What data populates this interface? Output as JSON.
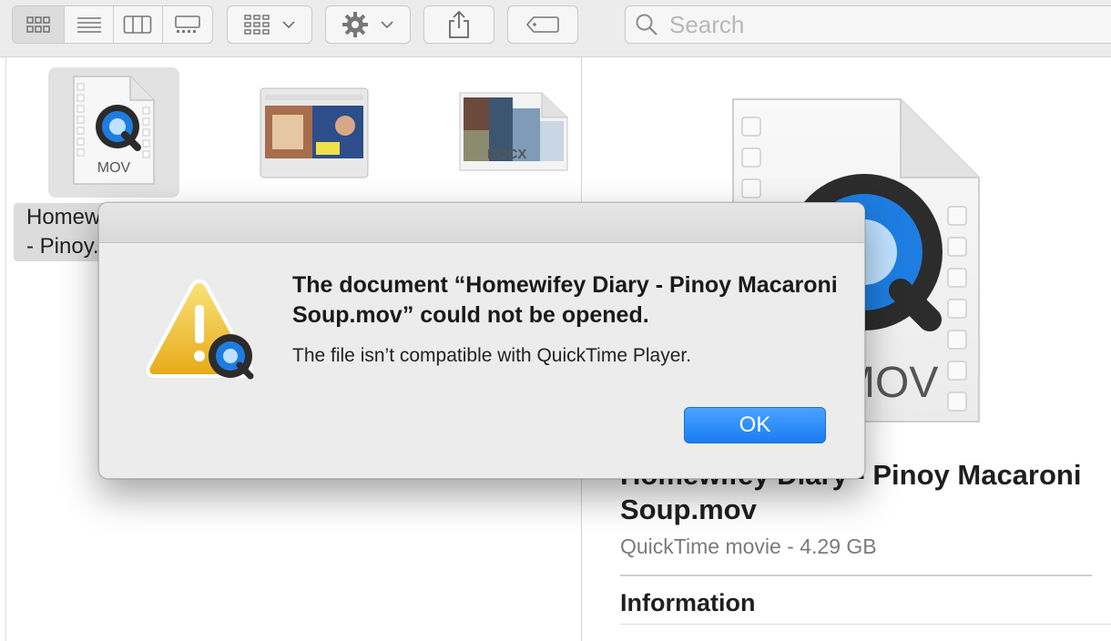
{
  "toolbar": {
    "view_modes": [
      {
        "name": "icon-view-icon",
        "active": true
      },
      {
        "name": "list-view-icon",
        "active": false
      },
      {
        "name": "column-view-icon",
        "active": false
      },
      {
        "name": "gallery-view-icon",
        "active": false
      }
    ],
    "group_icon": "group-by-icon",
    "action_icon": "gear-icon",
    "share_icon": "share-icon",
    "tag_icon": "tag-icon",
    "search_placeholder": "Search"
  },
  "files": [
    {
      "name": "Homewifey Diary - Pinoy Macaroni Soup.mov",
      "label_line1": "Homew",
      "label_line2": "- Pinoy.",
      "badge": "MOV",
      "selected": true
    },
    {
      "name": "slide-image",
      "badge": "",
      "selected": false
    },
    {
      "name": "docx-document",
      "badge": "DOCX",
      "selected": false
    }
  ],
  "preview": {
    "badge": "MOV",
    "title": "Homewifey Diary - Pinoy Macaroni Soup.mov",
    "subtitle": "QuickTime movie - 4.29 GB",
    "section": "Information"
  },
  "dialog": {
    "heading": "The document “Homewifey Diary - Pinoy Macaroni Soup.mov” could not be opened.",
    "body": "The file isn’t compatible with QuickTime Player.",
    "ok_label": "OK"
  },
  "colors": {
    "accent": "#1b7cf2",
    "quicktime_blue": "#1e7de0",
    "warning_yellow": "#f2c230"
  }
}
